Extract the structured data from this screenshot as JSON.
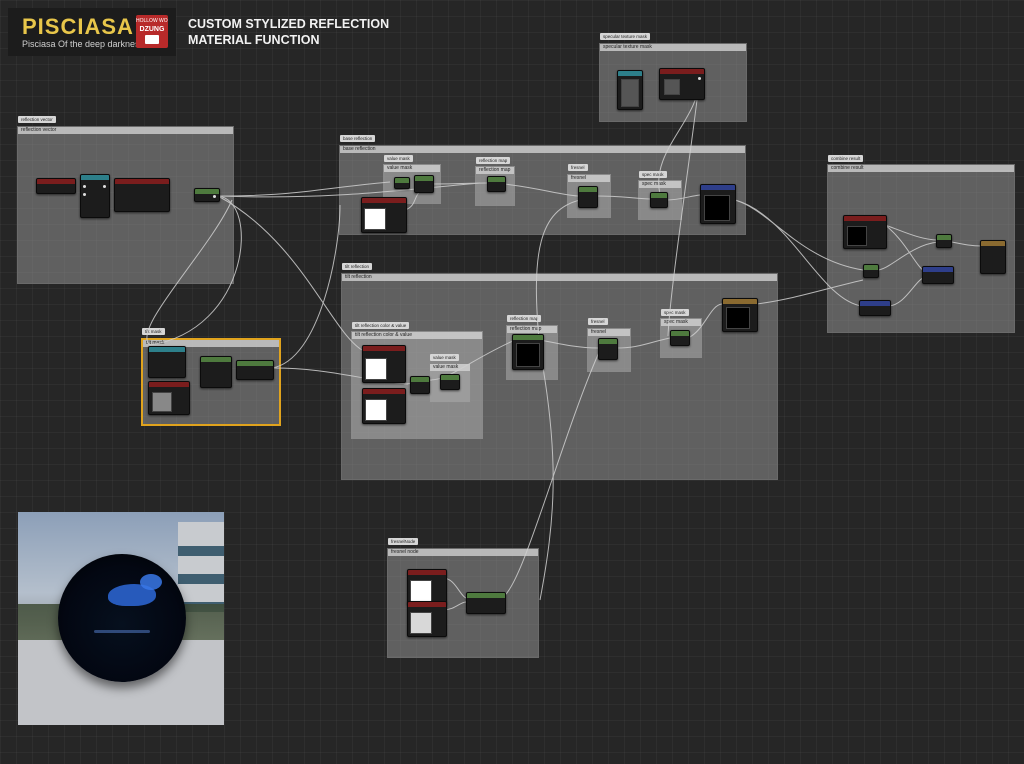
{
  "banner": {
    "logo": "PISCIASA",
    "tagline": "Pisciasa Of the deep darkness",
    "badge_top": "HOLLOW WORKSHOP",
    "badge_mid": "DZUNG"
  },
  "title": {
    "line1": "CUSTOM STYLIZED REFLECTION",
    "line2": "MATERIAL FUNCTION"
  },
  "comments": {
    "reflection_vector": {
      "tab": "reflection vector",
      "head": "reflection vector"
    },
    "specular": {
      "tab": "specular texture mask",
      "head": "specular texture mask"
    },
    "base": {
      "tab": "base reflection",
      "head": "base reflection"
    },
    "value_mask": {
      "tab": "value mask",
      "head": "value mask"
    },
    "reflection_map": {
      "tab": "reflection map",
      "head": "reflection map"
    },
    "fresnel": {
      "tab": "fresnel",
      "head": "fresnel"
    },
    "spec_mask": {
      "tab": "spec mask",
      "head": "spec mask"
    },
    "combine": {
      "tab": "combine result",
      "head": "combine result"
    },
    "tilt_mask": {
      "tab": "tilt mask",
      "head": "tilt mask"
    },
    "tilt_reflection": {
      "tab": "tilt reflection",
      "head": "tilt reflection"
    },
    "tilt_color": {
      "tab": "tilt reflection color & value",
      "head": "tilt reflection color & value"
    },
    "tilt_value_mask": {
      "tab": "value mask",
      "head": "value mask"
    },
    "tilt_reflection_map": {
      "tab": "reflection map",
      "head": "reflection map"
    },
    "tilt_fresnel": {
      "tab": "fresnel",
      "head": "fresnel"
    },
    "tilt_spec_mask": {
      "tab": "spec mask",
      "head": "spec mask"
    },
    "fresnel_node": {
      "tab": "fresnelNode",
      "head": "fresnel node"
    }
  },
  "colors": {
    "comment_select": "#e0a31d",
    "wire": "#d0d0d0",
    "node_input": "#7a1d1d",
    "node_math": "#4e7a3e",
    "node_texture": "#2e3e8a",
    "node_param": "#2d7f8a"
  },
  "icons": [
    "sphere-preview",
    "texture-thumbnail",
    "pin"
  ]
}
